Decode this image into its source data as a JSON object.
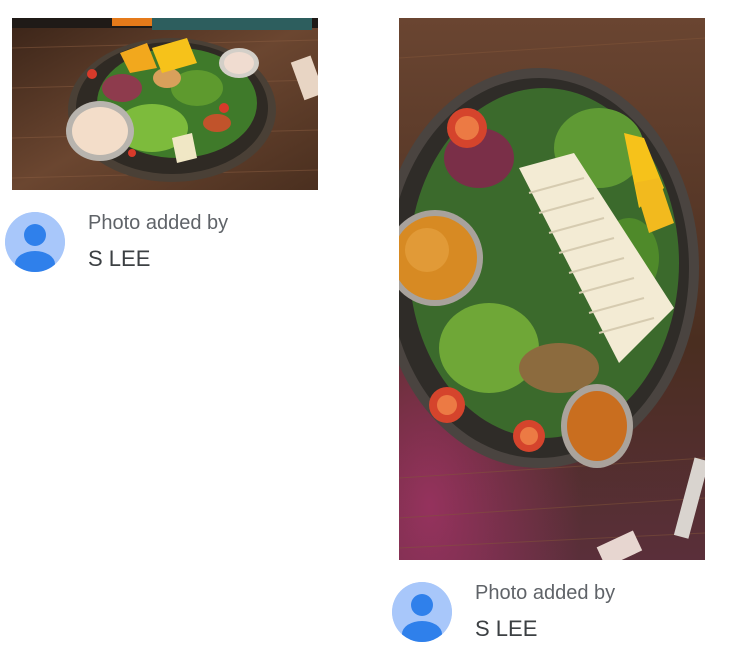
{
  "photos": [
    {
      "alt": "Salad with lemon wedges and dressing cup",
      "attribution": {
        "label": "Photo added by",
        "author": "S LEE"
      }
    },
    {
      "alt": "Salad with sliced tofu and dressing cups",
      "attribution": {
        "label": "Photo added by",
        "author": "S LEE"
      }
    }
  ],
  "colors": {
    "avatar_bg": "#a8c7fa",
    "avatar_fg": "#1a73e8",
    "label_text": "#5f6368",
    "name_text": "#3c4043"
  },
  "icons": {
    "avatar": "default-user-avatar-icon"
  }
}
